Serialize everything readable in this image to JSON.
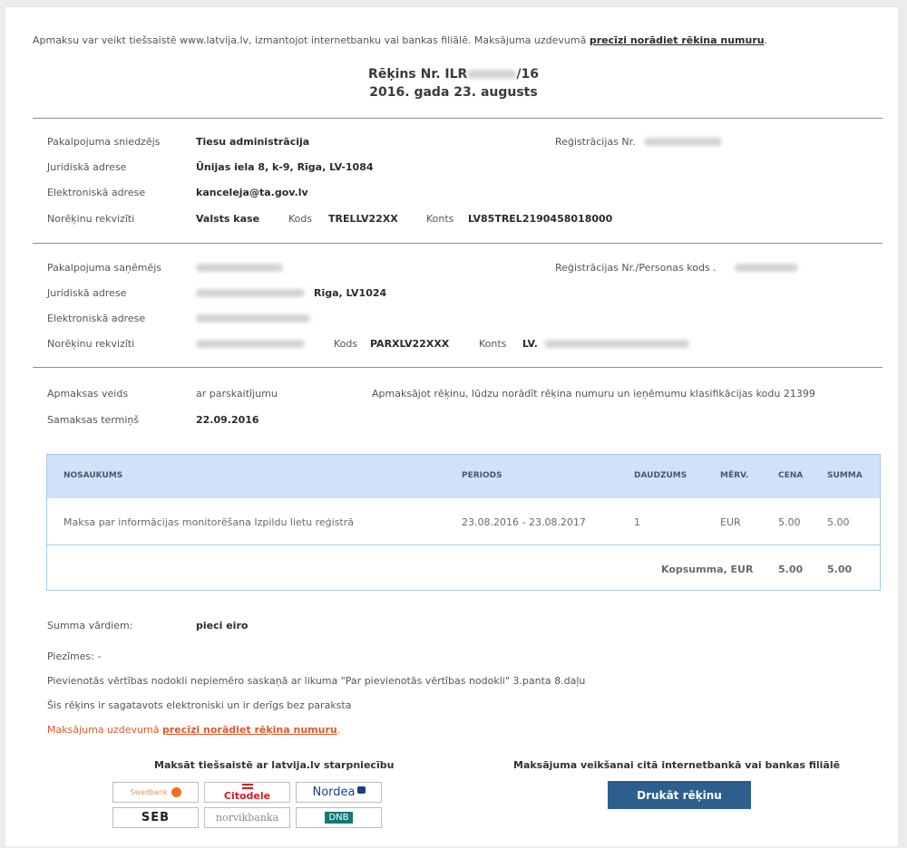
{
  "intro": {
    "text": "Apmaksu var veikt tiešsaistē www.latvija.lv, izmantojot internetbanku vai bankas filiālē. Maksājuma uzdevumā ",
    "link": "precīzi norādiet rēkina numuru",
    "end": "."
  },
  "invoice": {
    "number_prefix": "Rēķins Nr. ILR",
    "number_suffix": "/16",
    "date": "2016. gada 23. augusts"
  },
  "provider": {
    "label_name": "Pakalpojuma sniedzējs",
    "name": "Tiesu administrācija",
    "label_reg": "Reģistrācijas Nr.",
    "label_legal": "Juridiskā adrese",
    "legal": "Ūnijas iela 8, k-9, Rīga, LV-1084",
    "label_email": "Elektroniskā adrese",
    "email": "kanceleja@ta.gov.lv",
    "label_bank": "Norēķinu rekvizīti",
    "bank": "Valsts kase",
    "code_label": "Kods",
    "code": "TRELLV22XX",
    "account_label": "Konts",
    "account": "LV85TREL2190458018000"
  },
  "receiver": {
    "label_name": "Pakalpojuma saņēmējs",
    "label_reg": "Reģistrācijas Nr./Personas kods .",
    "label_legal": "Juridiskā adrese",
    "legal_city": "Rīga, LV1024",
    "label_email": "Elektroniskā adrese",
    "label_bank": "Norēķinu rekvizīti",
    "code_label": "Kods",
    "code": "PARXLV22XXX",
    "account_label": "Konts",
    "account": "LV."
  },
  "payment": {
    "label_type": "Apmaksas veids",
    "type": "ar parskaitījumu",
    "note": "Apmaksājot rēķinu, lūdzu norādīt rēķina numuru un ieņēmumu klasifikācijas kodu 21399",
    "label_due": "Samaksas termiņš",
    "due": "22.09.2016"
  },
  "table": {
    "headers": {
      "name": "NOSAUKUMS",
      "period": "PERIODS",
      "qty": "DAUDZUMS",
      "unit": "MĒRV.",
      "price": "CENA",
      "sum": "SUMMA"
    },
    "row": {
      "name": "Maksa par informācijas monitorēšana Izpildu lietu reģistrā",
      "period": "23.08.2016 - 23.08.2017",
      "qty": "1",
      "unit": "EUR",
      "price": "5.00",
      "sum": "5.00"
    },
    "total": {
      "label": "Kopsumma, EUR",
      "price": "5.00",
      "sum": "5.00"
    }
  },
  "footer": {
    "words_label": "Summa vārdiem:",
    "words": "pieci eiro",
    "notes": "Piezīmes: -",
    "vat": "Pievienotās vērtības nodokli nepiemēro saskaņā ar likuma \"Par pievienotās vērtības nodokli\" 3.panta 8.daļu",
    "electronic": "Šis rēķins ir sagatavots elektroniski un ir derīgs bez paraksta",
    "warn": "Maksājuma uzdevumā ",
    "warn_link": "precīzi norādiet rēķina numuru",
    "warn_end": "."
  },
  "online": {
    "title": "Maksāt tiešsaistē ar latvija.lv starpniecību",
    "banks": [
      "Swedbank",
      "Citodele",
      "Nordea",
      "SEB",
      "norvikbanka",
      "DNB"
    ]
  },
  "other": {
    "title": "Maksājuma veikšanai citā internetbankā vai bankas filiālē",
    "button": "Drukāt rēķinu"
  },
  "colors": {
    "accent": "#2c5f8e",
    "warn": "#e0582a",
    "table_head": "#cfe2f7"
  }
}
